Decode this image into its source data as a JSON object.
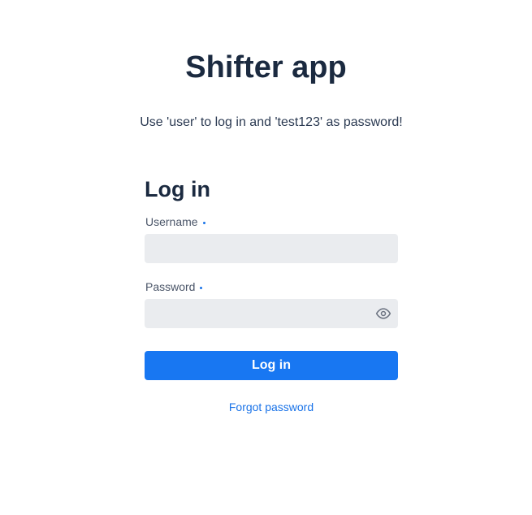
{
  "app": {
    "title": "Shifter app",
    "hint": "Use 'user' to log in and 'test123' as password!"
  },
  "login_form": {
    "title": "Log in",
    "username": {
      "label": "Username",
      "value": "",
      "placeholder": ""
    },
    "password": {
      "label": "Password",
      "value": "",
      "placeholder": ""
    },
    "submit_label": "Log in",
    "forgot_password_label": "Forgot password"
  },
  "colors": {
    "accent": "#1877f2",
    "input_background": "#eaecef",
    "title_text": "#1b2a40"
  },
  "icons": {
    "password_toggle": "eye-icon"
  }
}
